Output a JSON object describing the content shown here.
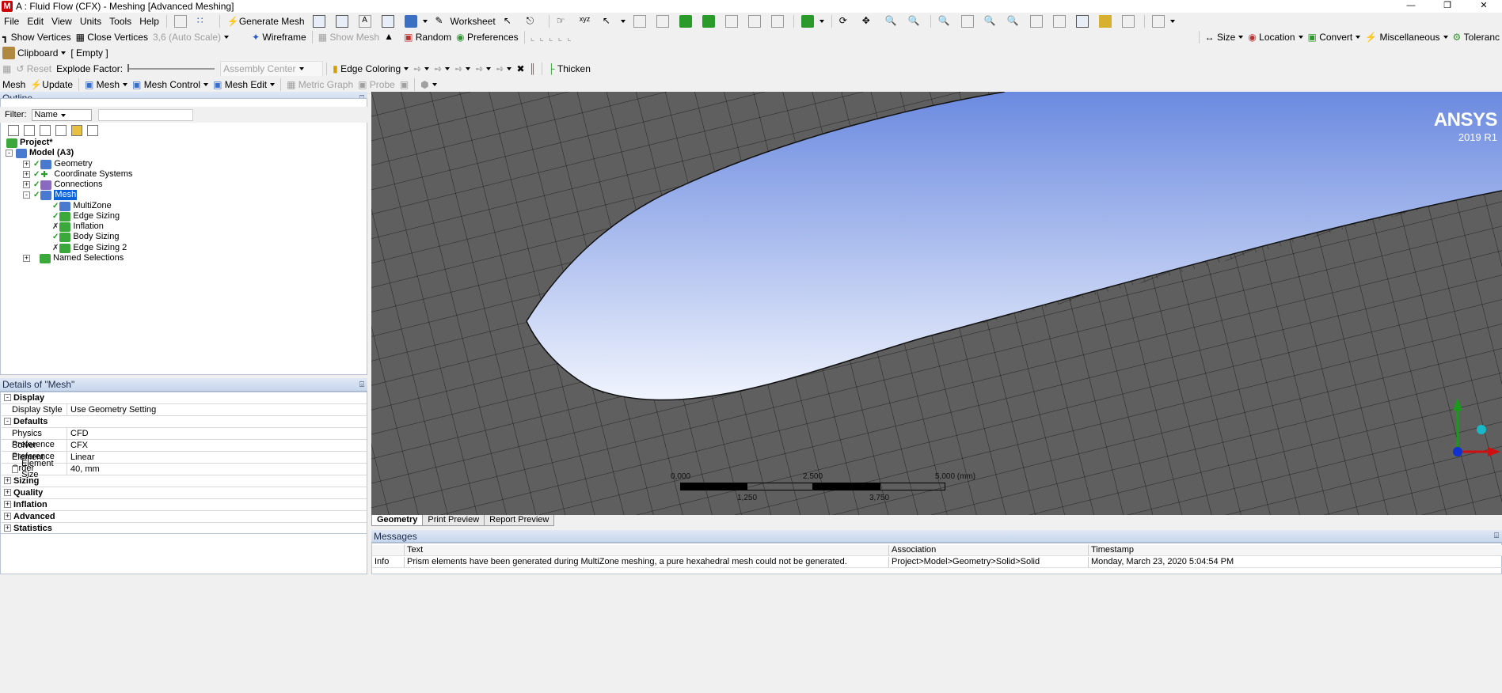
{
  "window": {
    "title": "A : Fluid Flow (CFX) - Meshing [Advanced Meshing]",
    "app_icon_letter": "M"
  },
  "menu": [
    "File",
    "Edit",
    "View",
    "Units",
    "Tools",
    "Help"
  ],
  "toolbar1": {
    "generate_mesh": "Generate Mesh",
    "worksheet": "Worksheet"
  },
  "toolbar2": {
    "show_vertices": "Show Vertices",
    "close_vertices": "Close Vertices",
    "scale_select": "3,6 (Auto Scale)",
    "wireframe": "Wireframe",
    "show_mesh": "Show Mesh",
    "random": "Random",
    "preferences": "Preferences",
    "size": "Size",
    "location": "Location",
    "convert": "Convert",
    "miscellaneous": "Miscellaneous",
    "tolerance": "Toleranc"
  },
  "toolbar3": {
    "clipboard": "Clipboard",
    "clipboard_value": "[ Empty ]"
  },
  "toolbar4": {
    "reset": "Reset",
    "explode_factor": "Explode Factor:",
    "assembly_center": "Assembly Center",
    "edge_coloring": "Edge Coloring",
    "thicken": "Thicken"
  },
  "toolbar5": {
    "mesh": "Mesh",
    "update": "Update",
    "mesh_dd": "Mesh",
    "mesh_control": "Mesh Control",
    "mesh_edit": "Mesh Edit",
    "metric_graph": "Metric Graph",
    "probe": "Probe"
  },
  "outline": {
    "title": "Outline",
    "filter_label": "Filter:",
    "filter_value": "Name",
    "tree": {
      "project": "Project*",
      "model": "Model (A3)",
      "geometry": "Geometry",
      "coordinate_systems": "Coordinate Systems",
      "connections": "Connections",
      "mesh": "Mesh",
      "multizone": "MultiZone",
      "edge_sizing": "Edge Sizing",
      "inflation": "Inflation",
      "body_sizing": "Body Sizing",
      "edge_sizing_2": "Edge Sizing 2",
      "named_selections": "Named Selections"
    }
  },
  "details": {
    "title": "Details of \"Mesh\"",
    "display": "Display",
    "display_style_k": "Display Style",
    "display_style_v": "Use Geometry Setting",
    "defaults": "Defaults",
    "physics_k": "Physics Preference",
    "physics_v": "CFD",
    "solver_k": "Solver Preference",
    "solver_v": "CFX",
    "order_k": "Element Order",
    "order_v": "Linear",
    "size_k": "Element Size",
    "size_v": "40, mm",
    "sizing": "Sizing",
    "quality": "Quality",
    "inflation": "Inflation",
    "advanced": "Advanced",
    "statistics": "Statistics"
  },
  "viewport": {
    "brand": "ANSYS",
    "version": "2019 R1",
    "scale": {
      "t0": "0,000",
      "t1": "2,500",
      "t2": "5,000 (mm)",
      "b1": "1,250",
      "b2": "3,750"
    }
  },
  "view_tabs": [
    "Geometry",
    "Print Preview",
    "Report Preview"
  ],
  "messages": {
    "title": "Messages",
    "headers": {
      "text": "Text",
      "association": "Association",
      "timestamp": "Timestamp"
    },
    "row": {
      "type": "Info",
      "text": "Prism elements have been generated during MultiZone meshing, a pure hexahedral mesh could not be generated.",
      "association": "Project>Model>Geometry>Solid>Solid",
      "timestamp": "Monday, March 23, 2020 5:04:54 PM"
    }
  },
  "colors": {
    "viewport_mesh": "#5f5f5f",
    "void_top": "#6f8ee0",
    "void_bottom": "#eef3fd",
    "selection": "#0a64d8"
  }
}
